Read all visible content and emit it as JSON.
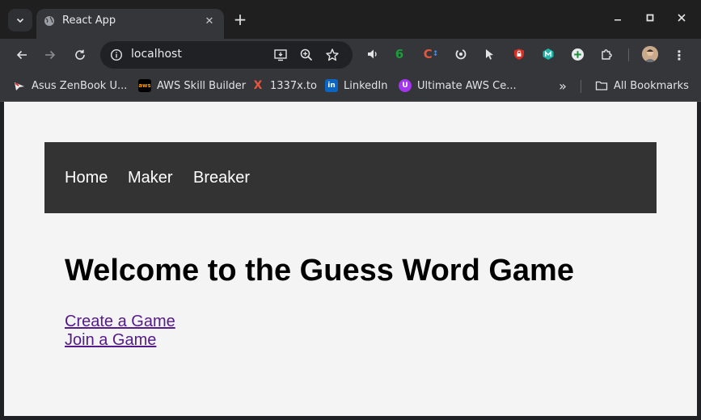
{
  "browser": {
    "tab": {
      "title": "React App"
    },
    "address": {
      "url": "localhost"
    },
    "extensions": [
      {
        "name": "volume",
        "icon": "speaker-icon"
      },
      {
        "name": "six",
        "text": "6",
        "color": "#1a9e3a"
      },
      {
        "name": "cf",
        "text": "C",
        "color": "#e8553d"
      },
      {
        "name": "sync",
        "icon": "circle-arrow-icon"
      },
      {
        "name": "cursor",
        "icon": "cursor-icon"
      },
      {
        "name": "shield",
        "icon": "red-shield-icon",
        "color": "#d93025"
      },
      {
        "name": "m",
        "text": "M",
        "color": "#1fb5a9"
      },
      {
        "name": "plus",
        "icon": "green-plus-icon",
        "color": "#1e8e3e"
      }
    ],
    "bookmarks": [
      {
        "label": "Asus ZenBook U..."
      },
      {
        "label": "AWS Skill Builder"
      },
      {
        "label": "1337x.to"
      },
      {
        "label": "LinkedIn"
      },
      {
        "label": "Ultimate AWS Ce..."
      }
    ],
    "all_bookmarks": "All Bookmarks"
  },
  "app": {
    "nav": [
      "Home",
      "Maker",
      "Breaker"
    ],
    "heading": "Welcome to the Guess Word Game",
    "links": [
      "Create a Game",
      "Join a Game"
    ]
  }
}
